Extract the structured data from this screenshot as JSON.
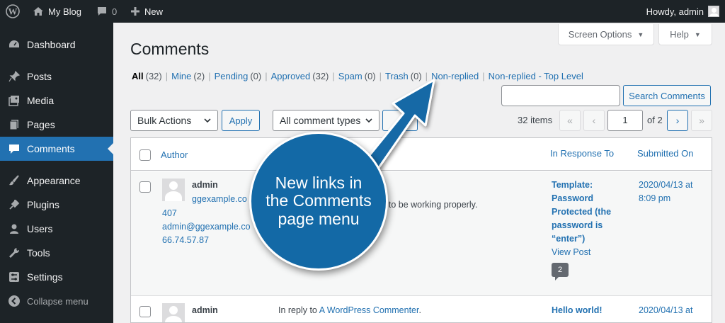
{
  "adminbar": {
    "site_name": "My Blog",
    "comments_count": "0",
    "new_label": "New",
    "howdy": "Howdy, admin"
  },
  "sidebar": {
    "items": [
      {
        "label": "Dashboard",
        "icon": "dashboard-icon"
      },
      {
        "label": "Posts",
        "icon": "pin-icon"
      },
      {
        "label": "Media",
        "icon": "media-icon"
      },
      {
        "label": "Pages",
        "icon": "pages-icon"
      },
      {
        "label": "Comments",
        "icon": "comment-icon",
        "current": true
      },
      {
        "label": "Appearance",
        "icon": "brush-icon"
      },
      {
        "label": "Plugins",
        "icon": "plug-icon"
      },
      {
        "label": "Users",
        "icon": "user-icon"
      },
      {
        "label": "Tools",
        "icon": "wrench-icon"
      },
      {
        "label": "Settings",
        "icon": "settings-icon"
      },
      {
        "label": "Collapse menu",
        "icon": "collapse-icon"
      }
    ]
  },
  "screen_meta": {
    "screen_options": "Screen Options",
    "help": "Help"
  },
  "page": {
    "title": "Comments"
  },
  "filters": {
    "all": {
      "label": "All",
      "count": "(32)"
    },
    "mine": {
      "label": "Mine",
      "count": "(2)"
    },
    "pending": {
      "label": "Pending",
      "count": "(0)"
    },
    "approved": {
      "label": "Approved",
      "count": "(32)"
    },
    "spam": {
      "label": "Spam",
      "count": "(0)"
    },
    "trash": {
      "label": "Trash",
      "count": "(0)"
    },
    "non_replied": {
      "label": "Non-replied"
    },
    "non_replied_top": {
      "label": "Non-replied - Top Level"
    },
    "sep": "|"
  },
  "search": {
    "value": "",
    "button": "Search Comments"
  },
  "tablenav": {
    "bulk_actions": "Bulk Actions",
    "apply": "Apply",
    "comment_types": "All comment types",
    "items": "32 items",
    "first": "«",
    "prev": "‹",
    "current_page": "1",
    "of_pages": "of 2",
    "next": "›",
    "last": "»"
  },
  "table": {
    "columns": {
      "author": "Author",
      "response": "In Response To",
      "submitted": "Submitted On"
    },
    "rows": [
      {
        "author": "admin",
        "url": "ggexample.co",
        "id": "407",
        "email": "admin@ggexample.co",
        "ip": "66.74.57.87",
        "comment": "rs to be working properly.",
        "response_lines": [
          "Template:",
          "Password",
          "Protected (the",
          "password is",
          "“enter”)"
        ],
        "view_post": "View Post",
        "bubble": "2",
        "date": "2020/04/13 at",
        "time": "8:09 pm"
      },
      {
        "author": "admin",
        "reply_prefix": "In reply to",
        "reply_link": "A WordPress Commenter",
        "reply_suffix": ".",
        "response_title": "Hello world!",
        "date": "2020/04/13 at"
      }
    ]
  },
  "callout": {
    "text": "New links in the Comments page menu",
    "color": "#1369a6"
  },
  "colors": {
    "accent": "#2271b1",
    "adminbar": "#1d2327",
    "background": "#f0f0f1"
  }
}
